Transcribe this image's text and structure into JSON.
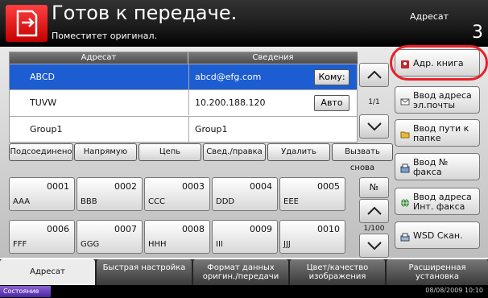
{
  "header": {
    "title": "Готов к передаче.",
    "subtitle": "Поместитет оригинал.",
    "right_label": "Адресат",
    "count": "3"
  },
  "table": {
    "col_headers": [
      "Адресат",
      "Сведения"
    ],
    "rows": [
      {
        "dest": "ABCD",
        "info": "abcd@efg.com",
        "btn": "Кому:"
      },
      {
        "dest": "TUVW",
        "info": "10.200.188.120",
        "btn": "Авто"
      },
      {
        "dest": "Group1",
        "info": "Group1",
        "btn": ""
      }
    ],
    "page": "1/1"
  },
  "side_buttons": [
    {
      "label": "Адр. книга"
    },
    {
      "label": "Ввод адреса эл.почты"
    },
    {
      "label": "Ввод пути к папке"
    },
    {
      "label": "Ввод № факса"
    },
    {
      "label": "Ввод адреса Инт. факса"
    },
    {
      "label": "WSD Скан."
    }
  ],
  "actions": [
    "Подсоединено",
    "Напрямую",
    "Цепь",
    "Свед./правка",
    "Удалить",
    "Вызвать снова"
  ],
  "tiles": [
    {
      "num": "0001",
      "name": "AAA"
    },
    {
      "num": "0002",
      "name": "BBB"
    },
    {
      "num": "0003",
      "name": "CCC"
    },
    {
      "num": "0004",
      "name": "DDD"
    },
    {
      "num": "0005",
      "name": "EEE"
    },
    {
      "num": "0006",
      "name": "FFF"
    },
    {
      "num": "0007",
      "name": "GGG"
    },
    {
      "num": "0008",
      "name": "HHH"
    },
    {
      "num": "0009",
      "name": "III"
    },
    {
      "num": "0010",
      "name": "JJJ"
    }
  ],
  "grid_nav": {
    "no_label": "№",
    "page": "1/100"
  },
  "tabs": [
    "Адресат",
    "Быстрая настройка",
    "Формат данных оригин./передачи",
    "Цвет/качество изображения",
    "Расширенная установка"
  ],
  "status": {
    "label": "Состояние",
    "datetime": "08/08/2009   10:10"
  }
}
